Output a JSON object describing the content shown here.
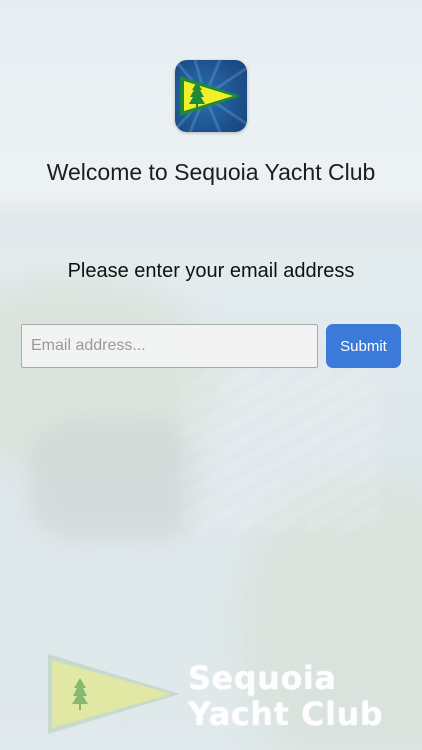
{
  "welcome": {
    "title": "Welcome to Sequoia Yacht Club"
  },
  "form": {
    "prompt": "Please enter your email address",
    "email_placeholder": "Email address...",
    "email_value": "",
    "submit_label": "Submit"
  },
  "watermark": {
    "line1": "Sequoia",
    "line2": "Yacht Club"
  },
  "colors": {
    "accent": "#3b7ad8",
    "icon_background": "#1c4f8a",
    "flag_yellow": "#f2ee2a",
    "tree_green": "#1f8a3a"
  },
  "icons": {
    "app_icon": "sequoia-burgee-flag",
    "watermark_flag": "sequoia-burgee-flag"
  }
}
